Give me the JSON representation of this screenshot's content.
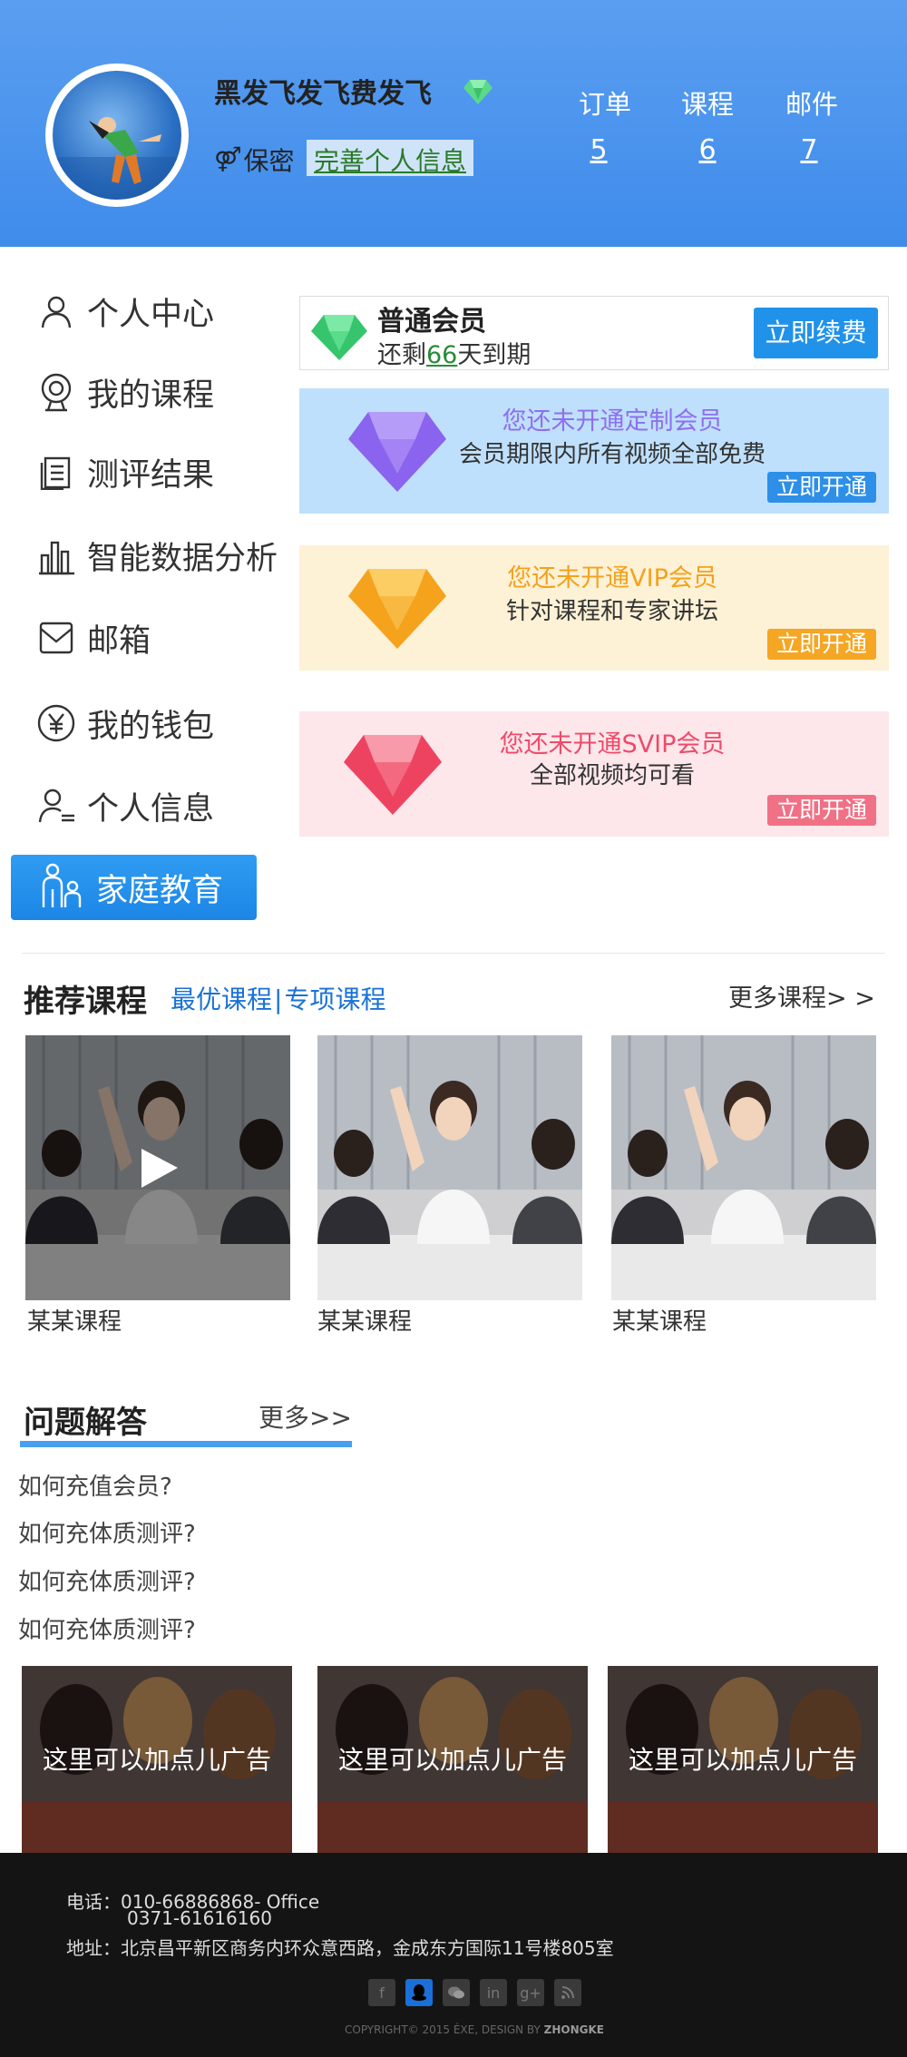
{
  "header": {
    "username": "黑发飞发飞费发飞",
    "privacy_label": "保密",
    "complete_info_link": "完善个人信息",
    "stats": [
      {
        "label": "订单",
        "value": "5"
      },
      {
        "label": "课程",
        "value": "6"
      },
      {
        "label": "邮件",
        "value": "7"
      }
    ]
  },
  "sidebar": {
    "items": [
      {
        "label": "个人中心",
        "icon": "user-icon"
      },
      {
        "label": "我的课程",
        "icon": "webcam-icon"
      },
      {
        "label": "测评结果",
        "icon": "document-icon"
      },
      {
        "label": "智能数据分析",
        "icon": "bar-chart-icon"
      },
      {
        "label": "邮箱",
        "icon": "mail-icon"
      },
      {
        "label": "我的钱包",
        "icon": "yen-icon"
      },
      {
        "label": "个人信息",
        "icon": "user-list-icon"
      },
      {
        "label": "家庭教育",
        "icon": "family-icon",
        "active": true
      }
    ]
  },
  "membership": {
    "basic": {
      "title": "普通会员",
      "remain_prefix": "还剩",
      "remain_days": "66",
      "remain_suffix": "天到期",
      "button": "立即续费"
    },
    "custom": {
      "title": "您还未开通定制会员",
      "desc": "会员期限内所有视频全部免费",
      "button": "立即开通",
      "color": "#8d6ff0"
    },
    "vip": {
      "title": "您还未开通VIP会员",
      "desc": "针对课程和专家讲坛",
      "button": "立即开通",
      "color": "#f3a21c"
    },
    "svip": {
      "title": "您还未开通SVIP会员",
      "desc": "全部视频均可看",
      "button": "立即开通",
      "color": "#ef4a6a"
    }
  },
  "recommend": {
    "title": "推荐课程",
    "tab1": "最优课程",
    "separator": "|",
    "tab2": "专项课程",
    "more": "更多课程> >",
    "courses": [
      {
        "name": "某某课程"
      },
      {
        "name": "某某课程"
      },
      {
        "name": "某某课程"
      }
    ]
  },
  "qa": {
    "title": "问题解答",
    "more": "更多>>",
    "items": [
      "如何充值会员?",
      "如何充体质测评?",
      "如何充体质测评?",
      "如何充体质测评?"
    ]
  },
  "ads": [
    "这里可以加点儿广告",
    "这里可以加点儿广告",
    "这里可以加点儿广告"
  ],
  "footer": {
    "phone_label": "电话：",
    "phone1": "010-66886868- Office",
    "phone2": "0371-61616160",
    "address": "地址：北京昌平新区商务内环众意西路，金成东方国际11号楼805室",
    "copyright_prefix": "COPYRIGHT© 2015 ÉXE, DESIGN BY",
    "copyright_brand": "ZHONGKE",
    "social": [
      "facebook-icon",
      "qq-icon",
      "wechat-icon",
      "linkedin-icon",
      "google-plus-icon",
      "rss-icon"
    ]
  }
}
